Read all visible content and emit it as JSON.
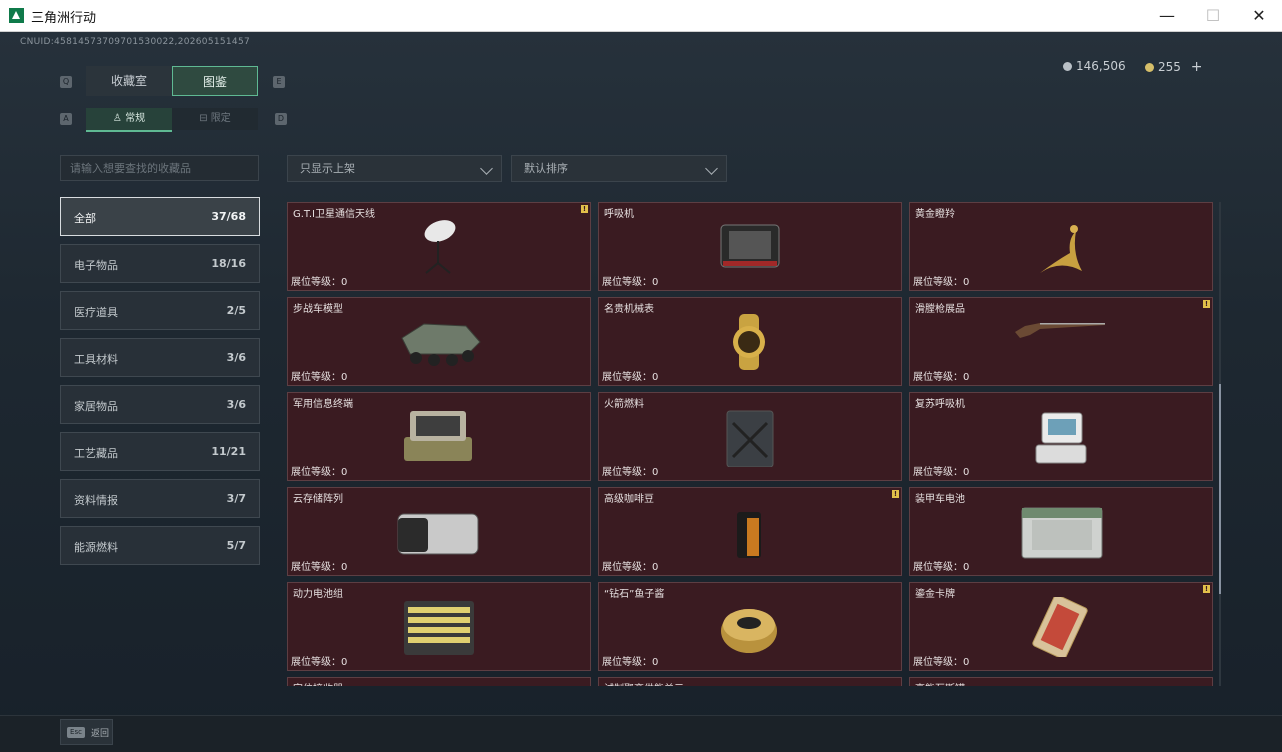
{
  "window": {
    "title": "三角洲行动",
    "min": "—",
    "max": "☐",
    "close": "✕"
  },
  "uid": "CNUID:45814573709701530022,202605151457",
  "currency": {
    "silver": "146,506",
    "gold": "255",
    "plus": "+"
  },
  "tabs": {
    "left_key": "Q",
    "right_key": "E",
    "collection": "收藏室",
    "gallery": "图鉴"
  },
  "subtabs": {
    "left_key": "A",
    "right_key": "D",
    "normal": "常规",
    "special": "限定"
  },
  "search": {
    "placeholder": "请输入想要查找的收藏品"
  },
  "filters": {
    "display": "只显示上架",
    "sort": "默认排序"
  },
  "categories": [
    {
      "label": "全部",
      "count": "37/68"
    },
    {
      "label": "电子物品",
      "count": "18/16"
    },
    {
      "label": "医疗道具",
      "count": "2/5"
    },
    {
      "label": "工具材料",
      "count": "3/6"
    },
    {
      "label": "家居物品",
      "count": "3/6"
    },
    {
      "label": "工艺藏品",
      "count": "11/21"
    },
    {
      "label": "资料情报",
      "count": "3/7"
    },
    {
      "label": "能源燃料",
      "count": "5/7"
    }
  ],
  "items": [
    {
      "name": "G.T.I卫星通信天线",
      "level": "展位等级：0",
      "flag": "!",
      "icon": "satellite-dish-icon"
    },
    {
      "name": "呼吸机",
      "level": "展位等级：0",
      "flag": "",
      "icon": "ventilator-icon"
    },
    {
      "name": "黄金瞪羚",
      "level": "展位等级：0",
      "flag": "",
      "icon": "gold-gazelle-icon"
    },
    {
      "name": "步战车模型",
      "level": "展位等级：0",
      "flag": "",
      "icon": "ifv-model-icon"
    },
    {
      "name": "名贵机械表",
      "level": "展位等级：0",
      "flag": "",
      "icon": "watch-icon"
    },
    {
      "name": "滑膛枪展品",
      "level": "展位等级：0",
      "flag": "!",
      "icon": "musket-icon"
    },
    {
      "name": "军用信息终端",
      "level": "展位等级：0",
      "flag": "",
      "icon": "military-terminal-icon"
    },
    {
      "name": "火箭燃料",
      "level": "展位等级：0",
      "flag": "",
      "icon": "fuel-can-icon"
    },
    {
      "name": "复苏呼吸机",
      "level": "展位等级：0",
      "flag": "",
      "icon": "resuscitator-icon"
    },
    {
      "name": "云存储阵列",
      "level": "展位等级：0",
      "flag": "",
      "icon": "storage-array-icon"
    },
    {
      "name": "高级咖啡豆",
      "level": "展位等级：0",
      "flag": "!",
      "icon": "coffee-bag-icon"
    },
    {
      "name": "装甲车电池",
      "level": "展位等级：0",
      "flag": "",
      "icon": "battery-icon"
    },
    {
      "name": "动力电池组",
      "level": "展位等级：0",
      "flag": "",
      "icon": "battery-pack-icon"
    },
    {
      "name": "“钻石”鱼子酱",
      "level": "展位等级：0",
      "flag": "",
      "icon": "caviar-tin-icon"
    },
    {
      "name": "鎏金卡牌",
      "level": "展位等级：0",
      "flag": "!",
      "icon": "gilded-card-icon"
    },
    {
      "name": "定位接收器",
      "level": "",
      "flag": "",
      "icon": ""
    },
    {
      "name": "试制聚变供能单元",
      "level": "",
      "flag": "",
      "icon": ""
    },
    {
      "name": "高能瓦斯罐",
      "level": "",
      "flag": "",
      "icon": ""
    }
  ],
  "bottom": {
    "esc_key": "Esc",
    "back": "返回"
  }
}
